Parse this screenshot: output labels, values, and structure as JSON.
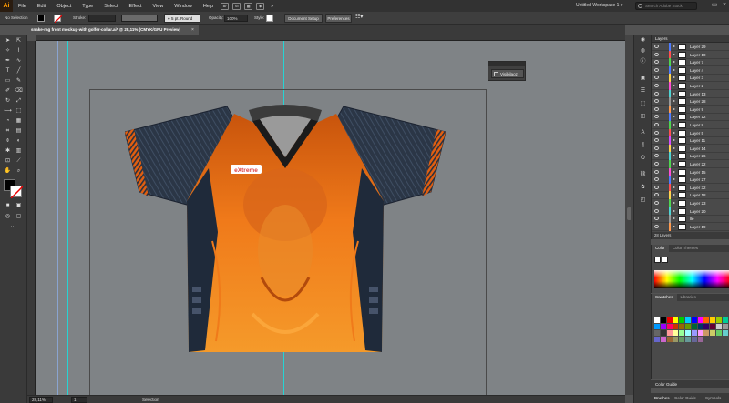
{
  "menubar": {
    "logo": "Ai",
    "items": [
      "File",
      "Edit",
      "Object",
      "Type",
      "Select",
      "Effect",
      "View",
      "Window",
      "Help"
    ],
    "icons": [
      "bridge-icon",
      "stock-icon",
      "arrange-icon",
      "gpu-icon",
      "send-icon"
    ],
    "bridge_label": "Br",
    "stock_label": "St",
    "workspace": "Untitled Workspace 1",
    "search_placeholder": "Search Adobe Stock"
  },
  "controlbar": {
    "selection": "No Selection",
    "stroke_label": "Stroke:",
    "brush": "5 pt. Round",
    "opacity_label": "Opacity:",
    "opacity_value": "100%",
    "style_label": "Style:",
    "document_setup": "Document Setup",
    "preferences": "Preferences"
  },
  "tab": {
    "title": "snake-rag front mockup-with golfer-collar.ai* @ 28,11% (CMYK/GPU Preview)",
    "close": "×"
  },
  "statusbar": {
    "zoom": "28,11%",
    "artboard": "1",
    "tool": "Selection"
  },
  "float_panel": {
    "button": "Visibilaoz"
  },
  "layers": {
    "tab": "Layers",
    "count": "28 Layers",
    "items": [
      {
        "name": "Layer 29",
        "color": "#4f7cff"
      },
      {
        "name": "Layer 10",
        "color": "#ff4f4f"
      },
      {
        "name": "Layer 7",
        "color": "#4fd44f"
      },
      {
        "name": "Layer 4",
        "color": "#4f7cff"
      },
      {
        "name": "Layer 3",
        "color": "#ffd34f"
      },
      {
        "name": "Layer 2",
        "color": "#ff4fd4"
      },
      {
        "name": "Layer 13",
        "color": "#4fd4d4"
      },
      {
        "name": "Layer 28",
        "color": "#9a9a9a"
      },
      {
        "name": "Layer 9",
        "color": "#ff9a4f"
      },
      {
        "name": "Layer 12",
        "color": "#4f7cff"
      },
      {
        "name": "Layer 8",
        "color": "#4fd44f"
      },
      {
        "name": "Layer 5",
        "color": "#ff4f4f"
      },
      {
        "name": "Layer 11",
        "color": "#d44fff"
      },
      {
        "name": "Layer 14",
        "color": "#ffd34f"
      },
      {
        "name": "Layer 26",
        "color": "#4fd4d4"
      },
      {
        "name": "Layer 22",
        "color": "#4fd44f"
      },
      {
        "name": "Layer 15",
        "color": "#ff4fd4"
      },
      {
        "name": "Layer 27",
        "color": "#4f7cff"
      },
      {
        "name": "Layer 32",
        "color": "#ff4f4f"
      },
      {
        "name": "Layer 18",
        "color": "#ffd34f"
      },
      {
        "name": "Layer 23",
        "color": "#4fd44f"
      },
      {
        "name": "Layer 20",
        "color": "#4fd4d4"
      },
      {
        "name": "lle",
        "color": "#9a9a9a"
      },
      {
        "name": "Layer 19",
        "color": "#ff9a4f"
      }
    ]
  },
  "color_panel": {
    "tabs": [
      "Color",
      "Color Themes"
    ]
  },
  "swatches_panel": {
    "tabs": [
      "Swatches",
      "Libraries"
    ]
  },
  "color_guide": {
    "label": "Color Guide"
  },
  "bottom_tabs": [
    "Brushes",
    "Color Guide",
    "Symbols"
  ],
  "brand": {
    "logo_text": "eXtreme"
  },
  "colors": {
    "orange_primary": "#f07a1a",
    "orange_dark": "#c8540c",
    "navy": "#1f2a3a",
    "canvas": "#7f8386",
    "guide": "#26d4d4"
  }
}
